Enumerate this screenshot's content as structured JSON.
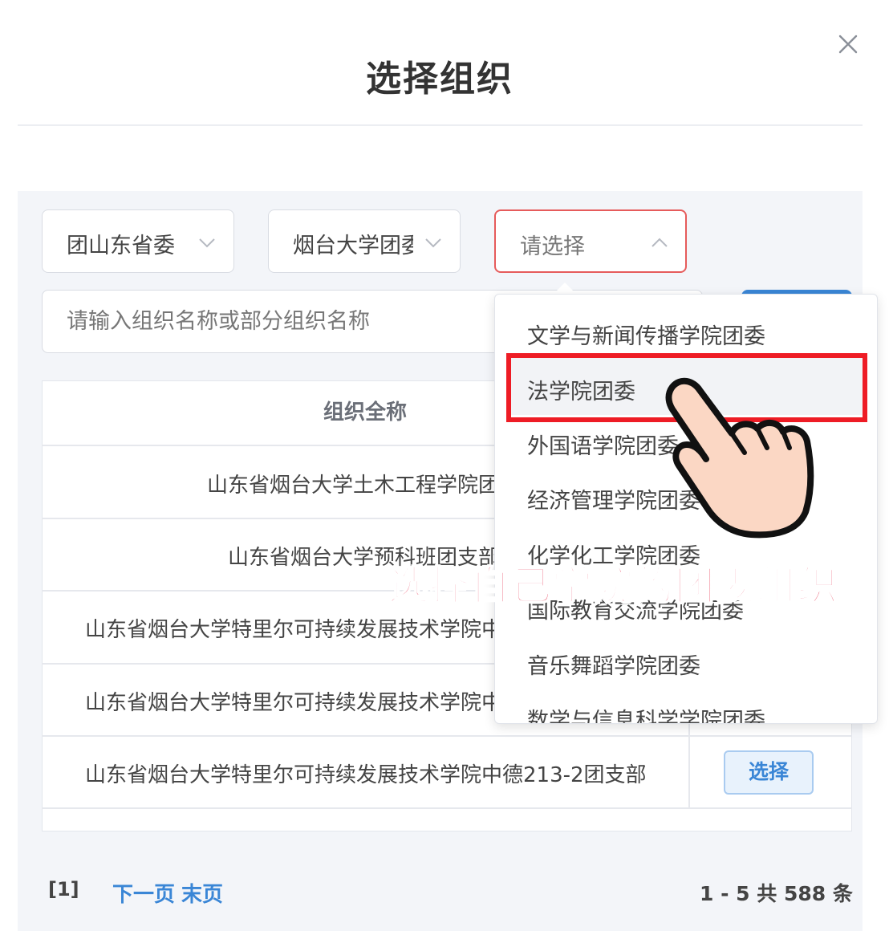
{
  "modal": {
    "title": "选择组织"
  },
  "filters": {
    "province": "团山东省委",
    "school": "烟台大学团委",
    "college_placeholder": "请选择"
  },
  "search": {
    "placeholder": "请输入组织名称或部分组织名称"
  },
  "table": {
    "header": "组织全称",
    "rows": [
      {
        "name": "山东省烟台大学土木工程学院团"
      },
      {
        "name": "山东省烟台大学预科班团支部"
      },
      {
        "name": "山东省烟台大学特里尔可持续发展技术学院中"
      },
      {
        "name": "山东省烟台大学特里尔可持续发展技术学院中"
      },
      {
        "name": "山东省烟台大学特里尔可持续发展技术学院中德213-2团支部",
        "action": "选择"
      }
    ]
  },
  "dropdown": {
    "options": [
      "文学与新闻传播学院团委",
      "法学院团委",
      "外国语学院团委",
      "经济管理学院团委",
      "化学化工学院团委",
      "国际教育交流学院团委",
      "音乐舞蹈学院团委",
      "数学与信息科学学院团委"
    ],
    "highlighted_index": 1
  },
  "annotation": {
    "text": "选择自己学院的团委组织",
    "color": "#e8415c"
  },
  "pagination": {
    "current": "[1]",
    "next": "下一页",
    "last": "末页",
    "total": "1 - 5  共 588 条"
  },
  "colors": {
    "primary": "#3a86d6",
    "highlight_box": "#ee1c25",
    "active_border": "#e65b5b"
  }
}
